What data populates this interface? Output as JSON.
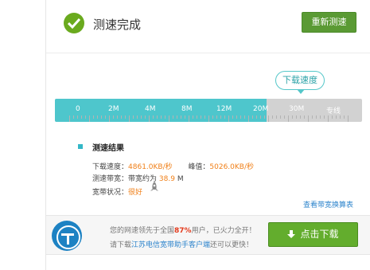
{
  "header": {
    "title": "测速完成",
    "retest_label": "重新测速"
  },
  "speed_indicator": {
    "bubble_label": "下载速度",
    "bar_labels": [
      "0",
      "2M",
      "4M",
      "8M",
      "12M",
      "20M",
      "30M",
      "专线"
    ],
    "fill_fraction": 0.69
  },
  "results": {
    "title": "测速结果",
    "download_label": "下载速度：",
    "download_value": "4861.0KB/秒",
    "peak_label": "峰值：",
    "peak_value": "5026.0KB/秒",
    "bandwidth_label": "测速带宽：带宽约为",
    "bandwidth_value": "38.9",
    "bandwidth_unit": "M",
    "status_label": "宽带状况：",
    "status_value": "很好",
    "formula_link": "查看带宽换算表"
  },
  "footer": {
    "line1_prefix": "您的网速领先于全国",
    "line1_percent": "87%",
    "line1_suffix": "用户，已火力全开！",
    "line2_prefix": "请下载",
    "line2_link": "江苏电信宽带助手客户端",
    "line2_suffix": "还可以更快！",
    "download_label": "点击下载"
  },
  "colors": {
    "accent_teal": "#4ec6cc",
    "button_green": "#63ad2d",
    "orange": "#f07f17",
    "link_blue": "#2d84cc"
  },
  "icons": {
    "status": "check-circle-icon",
    "rocket": "rocket-icon",
    "download": "download-arrow-icon",
    "logo": "telecom-logo-icon"
  }
}
